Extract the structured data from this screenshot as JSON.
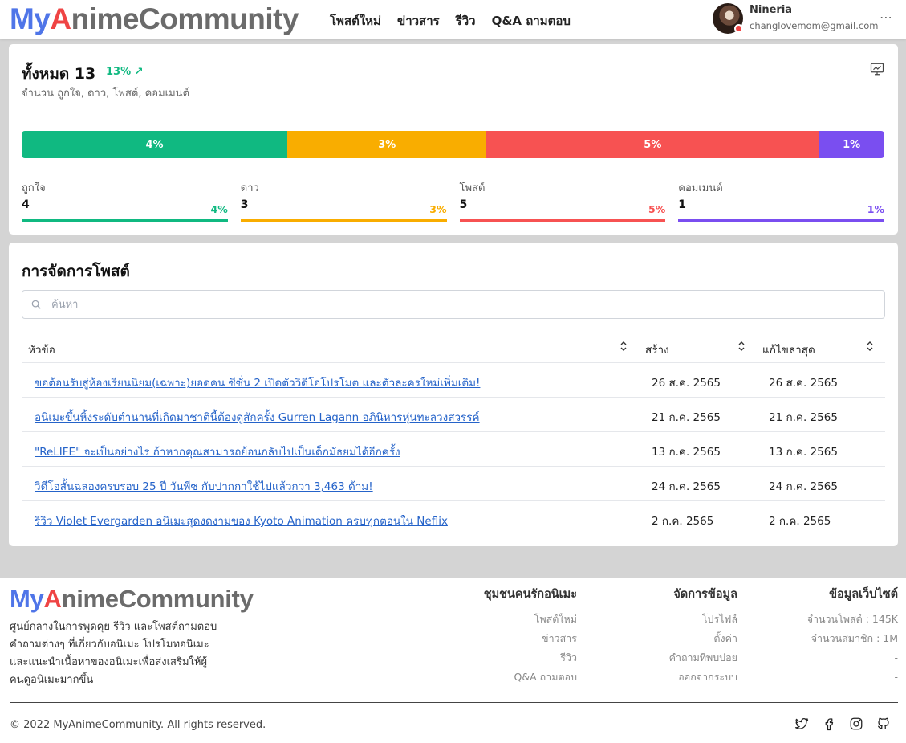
{
  "header": {
    "logo": {
      "my": "My",
      "a": "A",
      "rest": "nimeCommunity"
    },
    "nav": [
      "โพสต์ใหม่",
      "ข่าวสาร",
      "รีวิว",
      "Q&A ถามตอบ"
    ],
    "user": {
      "name": "Nineria",
      "email": "changlovemom@gmail.com"
    }
  },
  "stats": {
    "title": "ทั้งหมด 13",
    "growth": "13%",
    "subtitle": "จำนวน ถูกใจ, ดาว, โพสต์, คอมเมนต์",
    "segments": [
      {
        "label": "4%",
        "fraction": 0.308,
        "color": "#10b981"
      },
      {
        "label": "3%",
        "fraction": 0.231,
        "color": "#f9ad00"
      },
      {
        "label": "5%",
        "fraction": 0.385,
        "color": "#f75252"
      },
      {
        "label": "1%",
        "fraction": 0.076,
        "color": "#7a4ef0"
      }
    ],
    "kpis": [
      {
        "label": "ถูกใจ",
        "value": "4",
        "pct": "4%",
        "color": "#10b981"
      },
      {
        "label": "ดาว",
        "value": "3",
        "pct": "3%",
        "color": "#f9ad00"
      },
      {
        "label": "โพสต์",
        "value": "5",
        "pct": "5%",
        "color": "#f75252"
      },
      {
        "label": "คอมเมนต์",
        "value": "1",
        "pct": "1%",
        "color": "#7a4ef0"
      }
    ]
  },
  "posts": {
    "title": "การจัดการโพสต์",
    "search_placeholder": "ค้นหา",
    "columns": [
      "หัวข้อ",
      "สร้าง",
      "แก้ไขล่าสุด"
    ],
    "rows": [
      {
        "title": "ขอต้อนรับสู่ห้องเรียนนิยม(เฉพาะ)ยอดคน ซีซั่น 2 เปิดตัววิดีโอโปรโมต และตัวละครใหม่เพิ่มเติม!",
        "created": "26 ส.ค. 2565",
        "updated": "26 ส.ค. 2565"
      },
      {
        "title": "อนิเมะขึ้นหิ้งระดับตำนานที่เกิดมาชาตินี้ต้องดูสักครั้ง Gurren Lagann อภินิหารหุ่นทะลวงสวรรค์",
        "created": "21 ก.ค. 2565",
        "updated": "21 ก.ค. 2565"
      },
      {
        "title": "\"ReLIFE\" จะเป็นอย่างไร ถ้าหากคุณสามารถย้อนกลับไปเป็นเด็กมัธยมได้อีกครั้ง",
        "created": "13 ก.ค. 2565",
        "updated": "13 ก.ค. 2565"
      },
      {
        "title": "วิดีโอสั้นฉลองครบรอบ 25 ปี วันพีซ กับปากกาใช้ไปแล้วกว่า 3,463 ด้าม!",
        "created": "24 ก.ค. 2565",
        "updated": "24 ก.ค. 2565"
      },
      {
        "title": "รีวิว Violet Evergarden อนิเมะสุดงดงามของ Kyoto Animation ครบทุกตอนใน Neflix",
        "created": "2 ก.ค. 2565",
        "updated": "2 ก.ค. 2565"
      }
    ]
  },
  "footer": {
    "logo": {
      "my": "My",
      "a": "A",
      "rest": "nimeCommunity"
    },
    "description": "ศูนย์กลางในการพูดคุย รีวิว และโพสต์ถามตอบคำถามต่างๆ ที่เกี่ยวกับอนิเมะ โปรโมทอนิเมะ และแนะนำเนื้อหาของอนิเมะเพื่อส่งเสริมให้ผู้คนดูอนิเมะมากขึ้น",
    "col1": {
      "title": "ชุมชนคนรักอนิเมะ",
      "items": [
        "โพสต์ใหม่",
        "ข่าวสาร",
        "รีวิว",
        "Q&A ถามตอบ"
      ]
    },
    "col2": {
      "title": "จัดการข้อมูล",
      "items": [
        "โปรไฟล์",
        "ตั้งค่า",
        "คำถามที่พบบ่อย",
        "ออกจากระบบ"
      ]
    },
    "col3": {
      "title": "ข้อมูลเว็บไซต์",
      "items": [
        "จำนวนโพสต์ : 145K",
        "จำนวนสมาชิก : 1M",
        "-",
        "-"
      ]
    },
    "copyright": "© 2022 MyAnimeCommunity. All rights reserved."
  }
}
